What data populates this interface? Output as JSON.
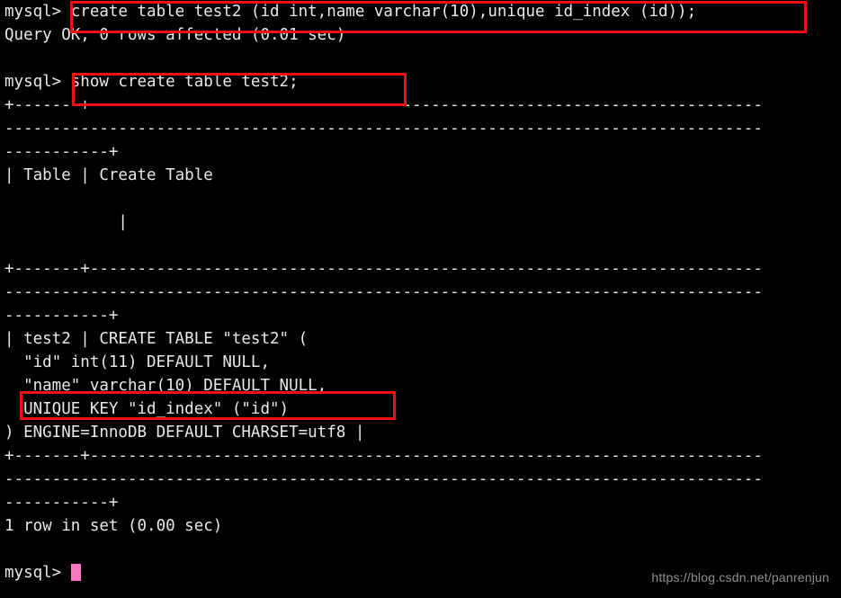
{
  "terminal": {
    "prompt": "mysql>",
    "background_color": "#000000",
    "text_color": "#e8e8e8",
    "cursor_color": "#ff79c0",
    "annotation_color": "#ee1111",
    "columns": 83,
    "lines": [
      {
        "id": "l01",
        "text": "mysql> create table test2 (id int,name varchar(10),unique id_index (id));"
      },
      {
        "id": "l02",
        "text": "Query OK, 0 rows affected (0.01 sec)"
      },
      {
        "id": "l03",
        "text": ""
      },
      {
        "id": "l04",
        "text": "mysql> show create table test2;"
      },
      {
        "id": "l05",
        "text": "+-------+-----------------------------------------------------------------------"
      },
      {
        "id": "l06",
        "text": "--------------------------------------------------------------------------------"
      },
      {
        "id": "l07",
        "text": "-----------+"
      },
      {
        "id": "l08",
        "text": "| Table | Create Table"
      },
      {
        "id": "l09",
        "text": ""
      },
      {
        "id": "l10",
        "text": "            |"
      },
      {
        "id": "l11",
        "text": ""
      },
      {
        "id": "l12",
        "text": "+-------+-----------------------------------------------------------------------"
      },
      {
        "id": "l13",
        "text": "--------------------------------------------------------------------------------"
      },
      {
        "id": "l14",
        "text": "-----------+"
      },
      {
        "id": "l15",
        "text": "| test2 | CREATE TABLE \"test2\" ("
      },
      {
        "id": "l16",
        "text": "  \"id\" int(11) DEFAULT NULL,"
      },
      {
        "id": "l17",
        "text": "  \"name\" varchar(10) DEFAULT NULL,"
      },
      {
        "id": "l18",
        "text": "  UNIQUE KEY \"id_index\" (\"id\")"
      },
      {
        "id": "l19",
        "text": ") ENGINE=InnoDB DEFAULT CHARSET=utf8 |"
      },
      {
        "id": "l20",
        "text": "+-------+-----------------------------------------------------------------------"
      },
      {
        "id": "l21",
        "text": "--------------------------------------------------------------------------------"
      },
      {
        "id": "l22",
        "text": "-----------+"
      },
      {
        "id": "l23",
        "text": "1 row in set (0.00 sec)"
      },
      {
        "id": "l24",
        "text": ""
      },
      {
        "id": "l25",
        "text": "mysql> ",
        "cursor": true
      }
    ]
  },
  "annotations": [
    {
      "id": "redbox-create-table",
      "label": "create table test2 (id int,name varchar(10),unique id_index (id));"
    },
    {
      "id": "redbox-show-create",
      "label": "show create table test2;"
    },
    {
      "id": "redbox-unique-key",
      "label": "UNIQUE KEY \"id_index\" (\"id\")"
    }
  ],
  "watermark": {
    "text": "https://blog.csdn.net/panrenjun"
  }
}
